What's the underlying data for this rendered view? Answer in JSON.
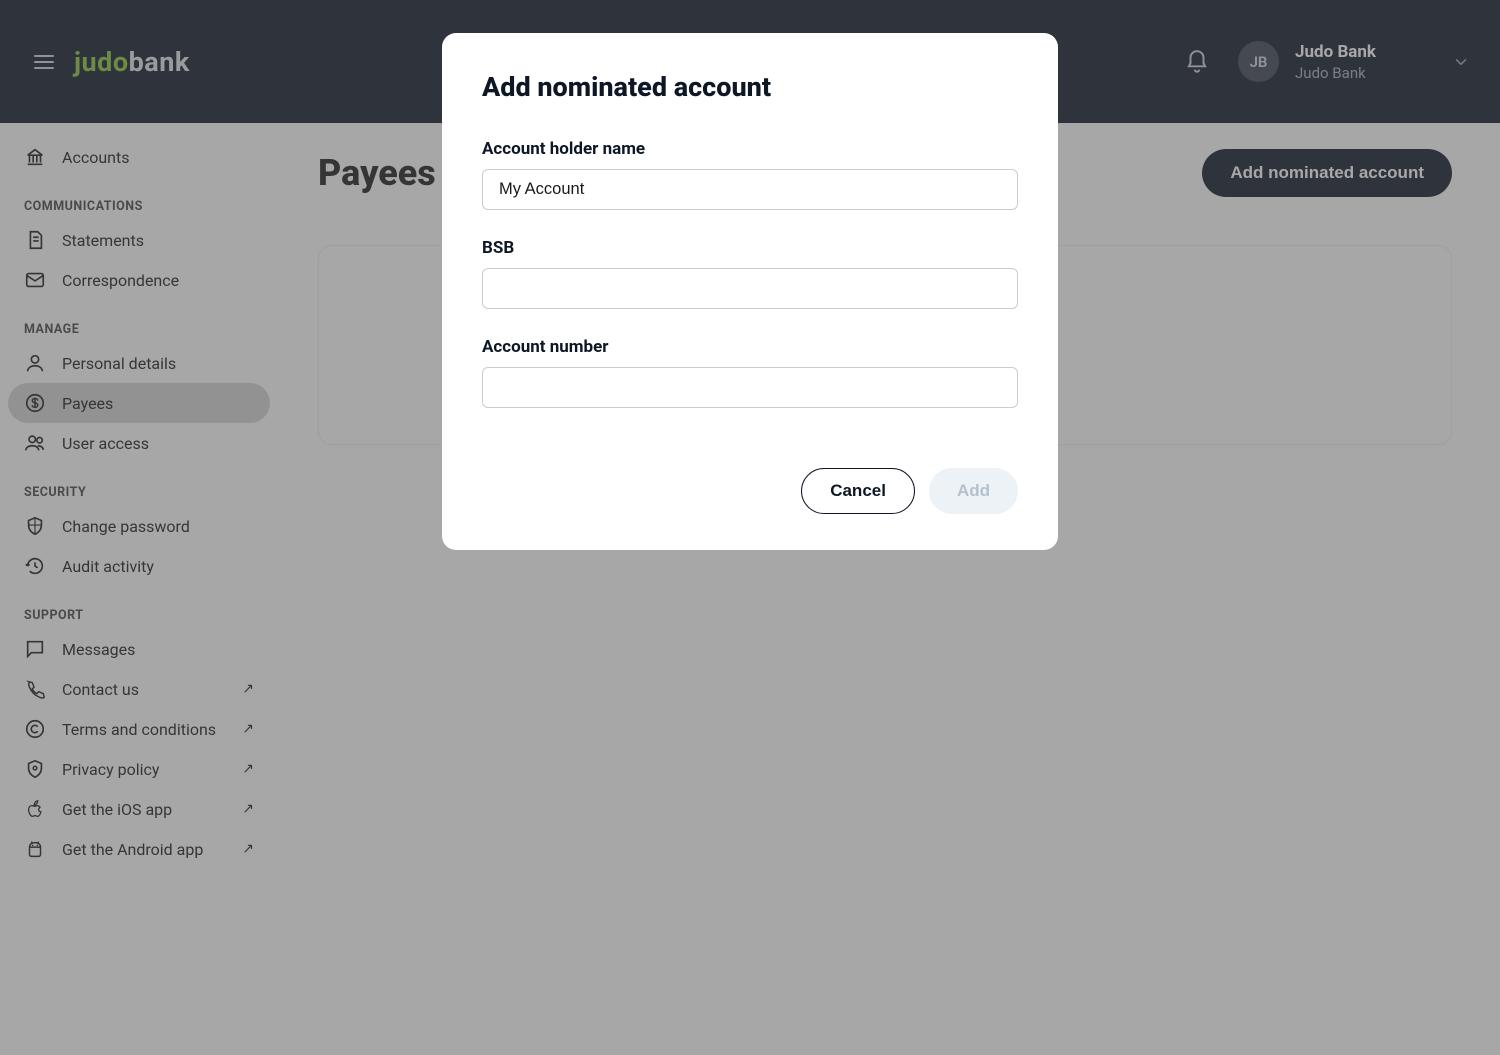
{
  "header": {
    "logo_part1": "judo",
    "logo_part2": "bank",
    "user": {
      "initials": "JB",
      "name": "Judo Bank",
      "subtitle": "Judo Bank"
    }
  },
  "sidebar": {
    "top_item": "Accounts",
    "sections": [
      {
        "label": "COMMUNICATIONS",
        "items": [
          {
            "name": "statements",
            "label": "Statements",
            "icon": "file-icon"
          },
          {
            "name": "correspondence",
            "label": "Correspondence",
            "icon": "mail-icon"
          }
        ]
      },
      {
        "label": "MANAGE",
        "items": [
          {
            "name": "personal-details",
            "label": "Personal details",
            "icon": "person-icon"
          },
          {
            "name": "payees",
            "label": "Payees",
            "icon": "dollar-icon",
            "active": true
          },
          {
            "name": "user-access",
            "label": "User access",
            "icon": "people-icon"
          }
        ]
      },
      {
        "label": "SECURITY",
        "items": [
          {
            "name": "change-password",
            "label": "Change password",
            "icon": "shield-icon"
          },
          {
            "name": "audit-activity",
            "label": "Audit activity",
            "icon": "history-icon"
          }
        ]
      },
      {
        "label": "SUPPORT",
        "items": [
          {
            "name": "messages",
            "label": "Messages",
            "icon": "chat-icon"
          },
          {
            "name": "contact-us",
            "label": "Contact us",
            "icon": "phone-icon",
            "external": true
          },
          {
            "name": "terms",
            "label": "Terms and conditions",
            "icon": "copyright-icon",
            "external": true
          },
          {
            "name": "privacy",
            "label": "Privacy policy",
            "icon": "privacy-icon",
            "external": true
          },
          {
            "name": "ios-app",
            "label": "Get the iOS app",
            "icon": "apple-icon",
            "external": true
          },
          {
            "name": "android-app",
            "label": "Get the Android app",
            "icon": "android-icon",
            "external": true
          }
        ]
      }
    ]
  },
  "main": {
    "title": "Payees",
    "add_button": "Add nominated account"
  },
  "modal": {
    "title": "Add nominated account",
    "fields": {
      "holder_label": "Account holder name",
      "holder_value": "My Account",
      "bsb_label": "BSB",
      "bsb_value": "",
      "acct_label": "Account number",
      "acct_value": ""
    },
    "cancel": "Cancel",
    "add": "Add"
  }
}
